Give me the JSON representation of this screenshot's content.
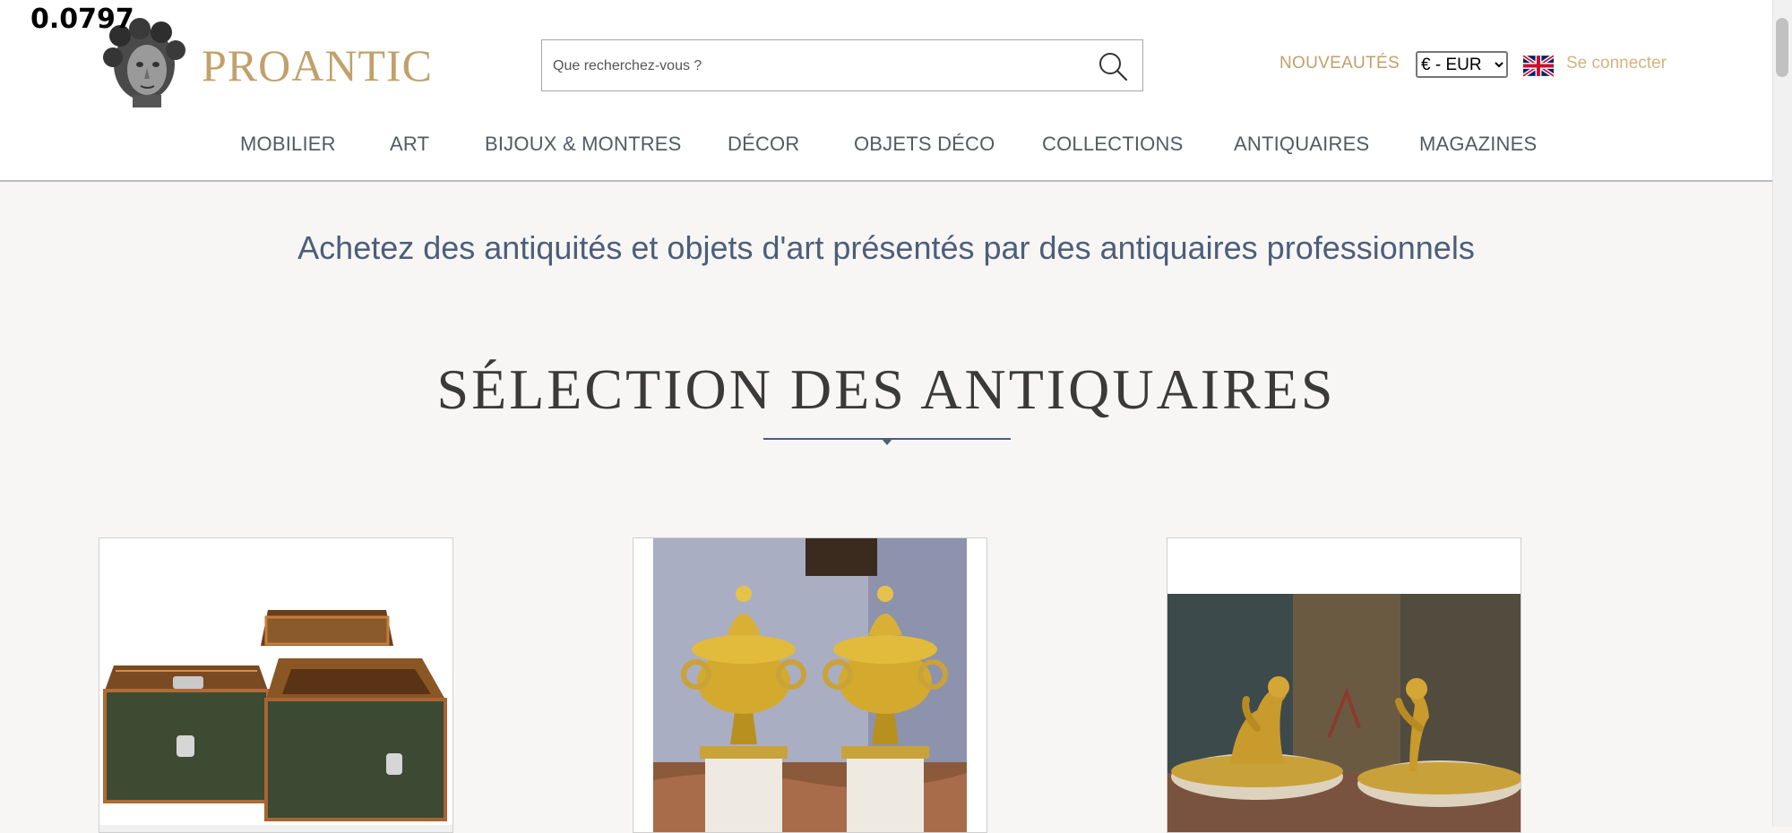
{
  "overlay": {
    "value": "0.0797"
  },
  "header": {
    "logo_text": "PROANTIC",
    "search_placeholder": "Que recherchez-vous ?",
    "nouveautes": "NOUVEAUTÉS",
    "currency": {
      "selected": "€ - EUR"
    },
    "login": "Se connecter",
    "icons": [
      "bust-logo-icon",
      "search-icon",
      "uk-flag-icon"
    ]
  },
  "nav": {
    "items": [
      {
        "label": "MOBILIER"
      },
      {
        "label": "ART"
      },
      {
        "label": "BIJOUX & MONTRES"
      },
      {
        "label": "DÉCOR"
      },
      {
        "label": "OBJETS DÉCO"
      },
      {
        "label": "COLLECTIONS"
      },
      {
        "label": "ANTIQUAIRES"
      },
      {
        "label": "MAGAZINES"
      }
    ]
  },
  "main": {
    "tagline": "Achetez des antiquités et objets d'art présentés par des antiquaires professionnels",
    "section_title": "SÉLECTION DES ANTIQUAIRES"
  },
  "colors": {
    "gold": "#c1a06b",
    "navy_text": "#4c5e7a",
    "background": "#f7f6f4"
  }
}
